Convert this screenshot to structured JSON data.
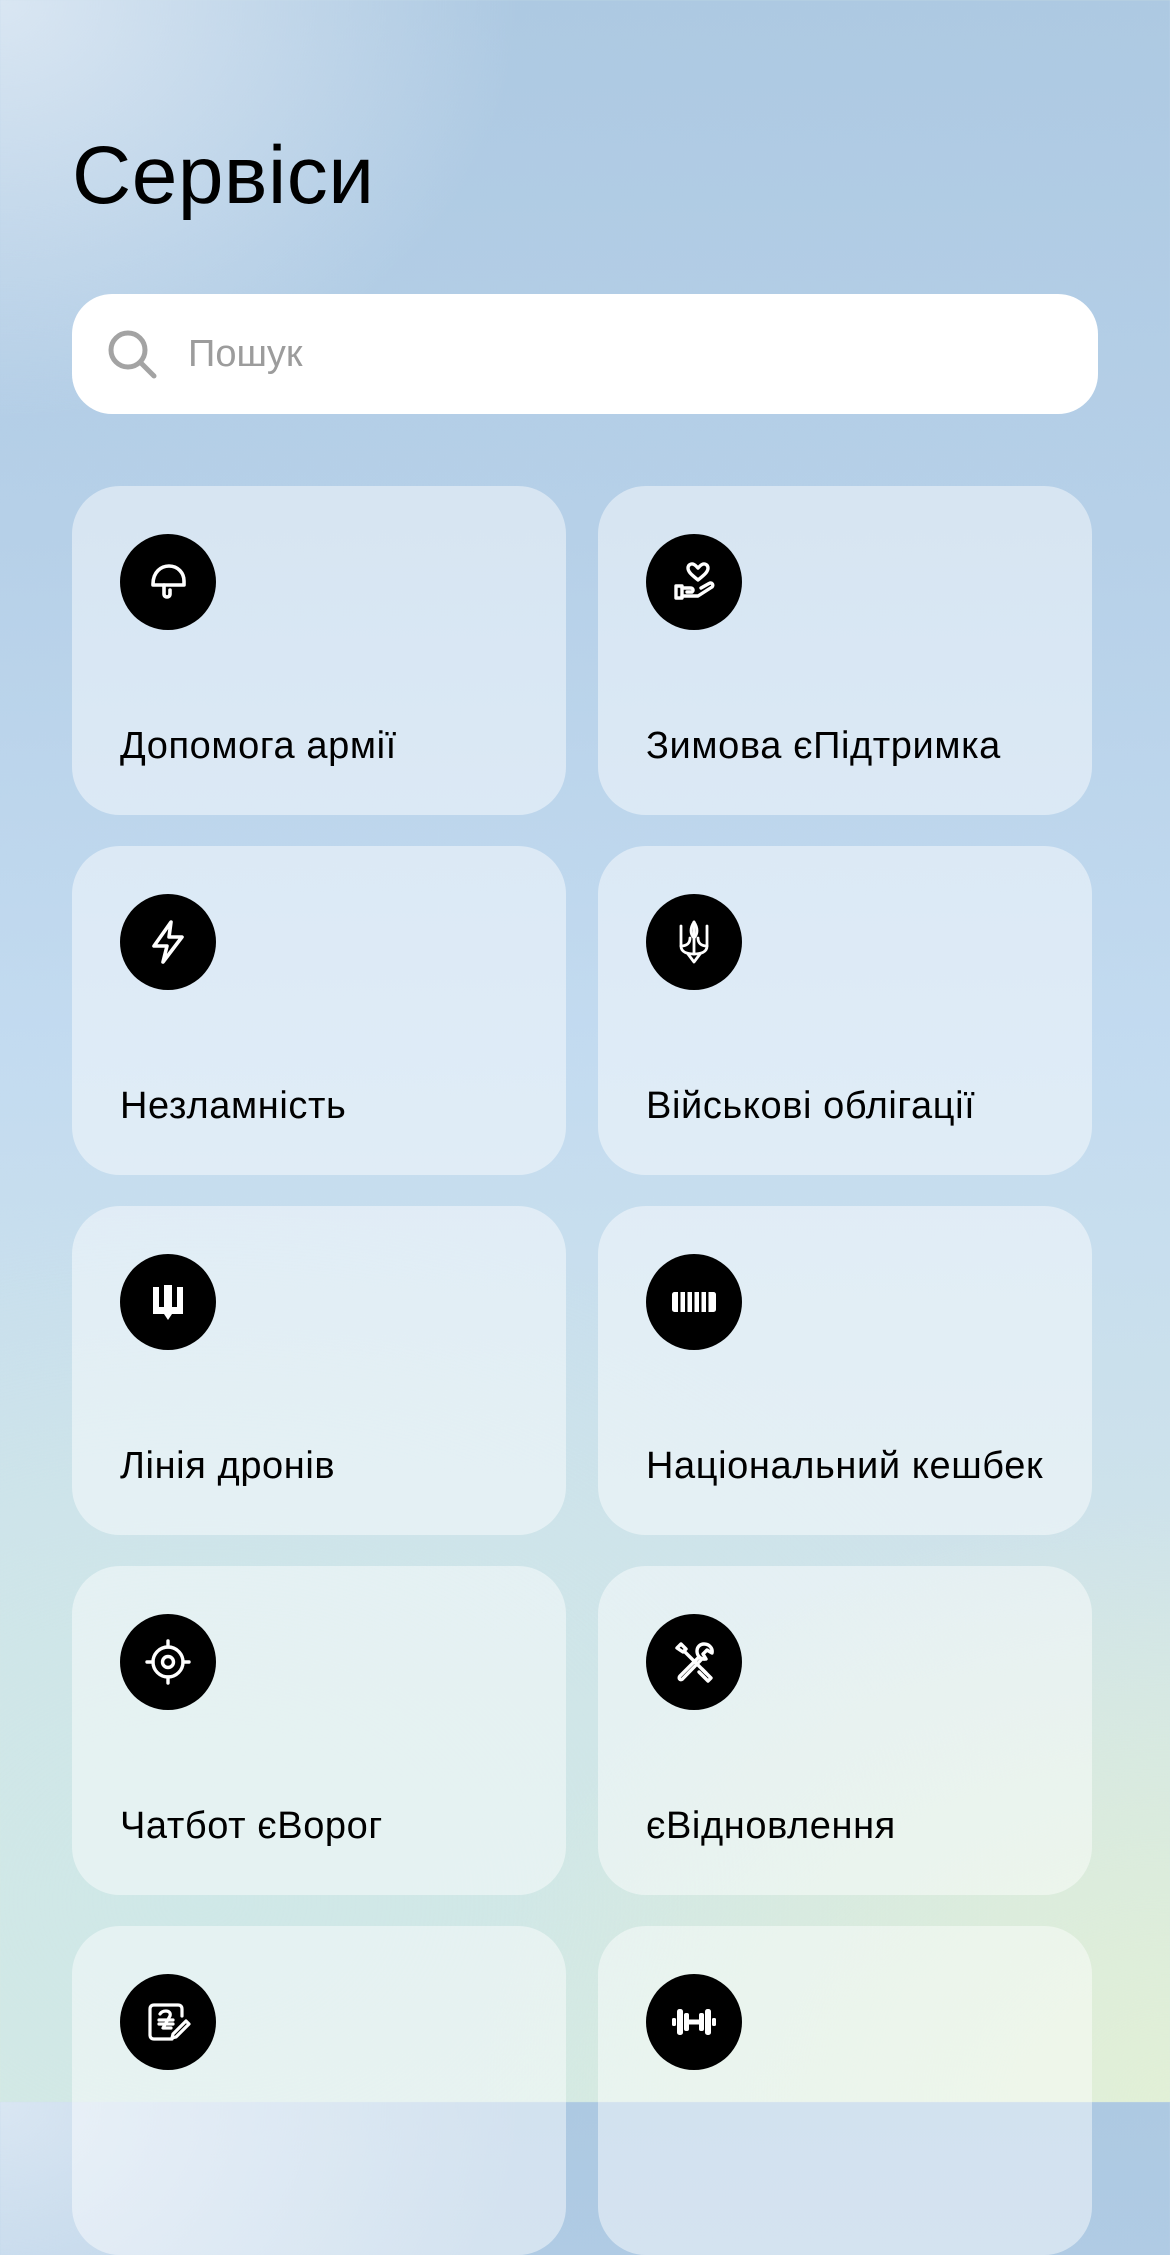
{
  "page": {
    "title": "Сервіси"
  },
  "search": {
    "placeholder": "Пошук",
    "icon": "search-icon"
  },
  "services": [
    {
      "label": "Допомога армії",
      "icon": "helmet-icon"
    },
    {
      "label": "Зимова єПідтримка",
      "icon": "heart-hand-icon"
    },
    {
      "label": "Незламність",
      "icon": "lightning-icon"
    },
    {
      "label": "Військові облігації",
      "icon": "trident-icon"
    },
    {
      "label": "Лінія дронів",
      "icon": "drone-trident-icon"
    },
    {
      "label": "Національний кешбек",
      "icon": "barcode-icon"
    },
    {
      "label": "Чатбот єВорог",
      "icon": "target-icon"
    },
    {
      "label": "єВідновлення",
      "icon": "tools-icon"
    },
    {
      "label": "",
      "icon": "hryvnia-document-icon"
    },
    {
      "label": "",
      "icon": "dumbbell-icon"
    }
  ]
}
